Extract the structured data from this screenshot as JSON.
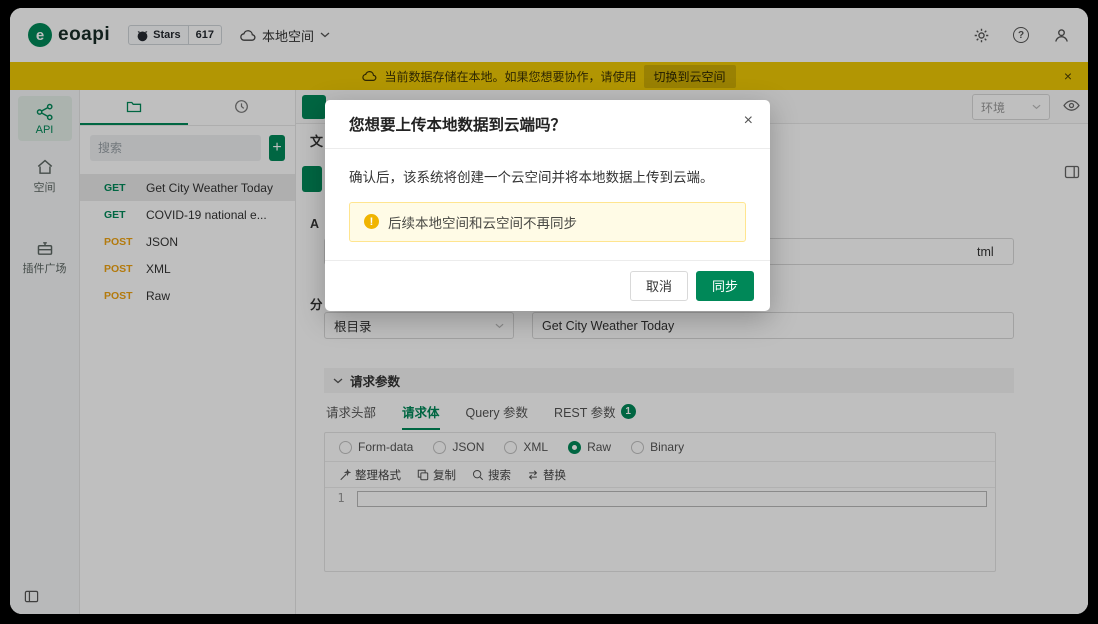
{
  "colors": {
    "accent": "#008858",
    "banner_gold": "#eec905",
    "post_orange": "#efa312",
    "alert_bg": "#fffbe6"
  },
  "header": {
    "logo": "eoapi",
    "stars_label": "Stars",
    "stars_count": "617",
    "workspace_label": "本地空间"
  },
  "banner": {
    "message": "当前数据存储在本地。如果您想要协作，请使用",
    "action": "切换到云空间",
    "close": "×"
  },
  "rail": {
    "items": [
      {
        "label": "API"
      },
      {
        "label": "空间"
      },
      {
        "label": "插件广场"
      }
    ]
  },
  "sidebar": {
    "search_placeholder": "搜索",
    "add_label": "+",
    "items": [
      {
        "method": "GET",
        "name": "Get City Weather Today"
      },
      {
        "method": "GET",
        "name": "COVID-19 national e..."
      },
      {
        "method": "POST",
        "name": "JSON"
      },
      {
        "method": "POST",
        "name": "XML"
      },
      {
        "method": "POST",
        "name": "Raw"
      }
    ]
  },
  "main": {
    "env_label": "环境",
    "partial_doc_label": "文",
    "partial_api_label": "A",
    "partial_group_label": "分",
    "url_visible_text": "tml",
    "group_value": "根目录",
    "name_value": "Get City Weather Today",
    "params_section": "请求参数",
    "tabs": [
      {
        "label": "请求头部"
      },
      {
        "label": "请求体"
      },
      {
        "label": "Query 参数"
      },
      {
        "label": "REST 参数"
      }
    ],
    "rest_badge": "1",
    "body_types": [
      {
        "label": "Form-data"
      },
      {
        "label": "JSON"
      },
      {
        "label": "XML"
      },
      {
        "label": "Raw"
      },
      {
        "label": "Binary"
      }
    ],
    "toolbar": [
      {
        "label": "整理格式"
      },
      {
        "label": "复制"
      },
      {
        "label": "搜索"
      },
      {
        "label": "替换"
      }
    ],
    "line_number": "1"
  },
  "modal": {
    "title": "您想要上传本地数据到云端吗？",
    "close": "×",
    "body": "确认后，该系统将创建一个云空间并将本地数据上传到云端。",
    "alert_icon": "!",
    "alert": "后续本地空间和云空间不再同步",
    "cancel": "取消",
    "confirm": "同步"
  }
}
